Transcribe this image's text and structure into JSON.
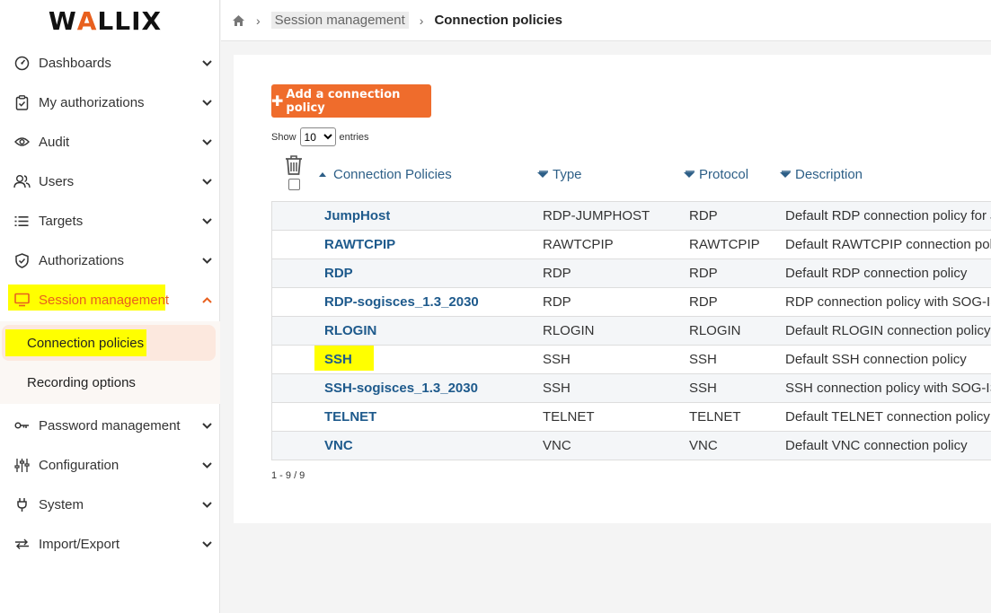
{
  "brand": {
    "logo_pre": "W",
    "logo_mark": "A",
    "logo_post": "LLIX"
  },
  "breadcrumb": {
    "parent": "Session management",
    "current": "Connection policies"
  },
  "sidebar": {
    "items": [
      {
        "label": "Dashboards",
        "icon": "dashboard-icon"
      },
      {
        "label": "My authorizations",
        "icon": "clipboard-check-icon"
      },
      {
        "label": "Audit",
        "icon": "eye-icon"
      },
      {
        "label": "Users",
        "icon": "users-icon"
      },
      {
        "label": "Targets",
        "icon": "list-icon"
      },
      {
        "label": "Authorizations",
        "icon": "shield-check-icon"
      },
      {
        "label": "Session management",
        "icon": "monitor-icon"
      },
      {
        "label": "Password management",
        "icon": "key-icon"
      },
      {
        "label": "Configuration",
        "icon": "sliders-icon"
      },
      {
        "label": "System",
        "icon": "plug-icon"
      },
      {
        "label": "Import/Export",
        "icon": "import-export-icon"
      }
    ],
    "sub_items": [
      {
        "label": "Connection policies"
      },
      {
        "label": "Recording options"
      }
    ]
  },
  "toolbar": {
    "add_label": "Add a connection policy"
  },
  "length_menu": {
    "show": "Show",
    "value": "10",
    "entries": "entries"
  },
  "columns": {
    "name": "Connection Policies",
    "type": "Type",
    "protocol": "Protocol",
    "description": "Description"
  },
  "rows": [
    {
      "name": "JumpHost",
      "type": "RDP-JUMPHOST",
      "protocol": "RDP",
      "description": "Default RDP connection policy for Ju"
    },
    {
      "name": "RAWTCPIP",
      "type": "RAWTCPIP",
      "protocol": "RAWTCPIP",
      "description": "Default RAWTCPIP connection polic"
    },
    {
      "name": "RDP",
      "type": "RDP",
      "protocol": "RDP",
      "description": "Default RDP connection policy"
    },
    {
      "name": "RDP-sogisces_1.3_2030",
      "type": "RDP",
      "protocol": "RDP",
      "description": "RDP connection policy with SOG-IS"
    },
    {
      "name": "RLOGIN",
      "type": "RLOGIN",
      "protocol": "RLOGIN",
      "description": "Default RLOGIN connection policy"
    },
    {
      "name": "SSH",
      "type": "SSH",
      "protocol": "SSH",
      "description": "Default SSH connection policy"
    },
    {
      "name": "SSH-sogisces_1.3_2030",
      "type": "SSH",
      "protocol": "SSH",
      "description": "SSH connection policy with SOG-IS C"
    },
    {
      "name": "TELNET",
      "type": "TELNET",
      "protocol": "TELNET",
      "description": "Default TELNET connection policy"
    },
    {
      "name": "VNC",
      "type": "VNC",
      "protocol": "VNC",
      "description": "Default VNC connection policy"
    }
  ],
  "pagination": {
    "info": "1 - 9 / 9"
  },
  "colors": {
    "accent": "#ef6c2c",
    "highlight": "#ffff00",
    "link": "#1e5a8c"
  }
}
